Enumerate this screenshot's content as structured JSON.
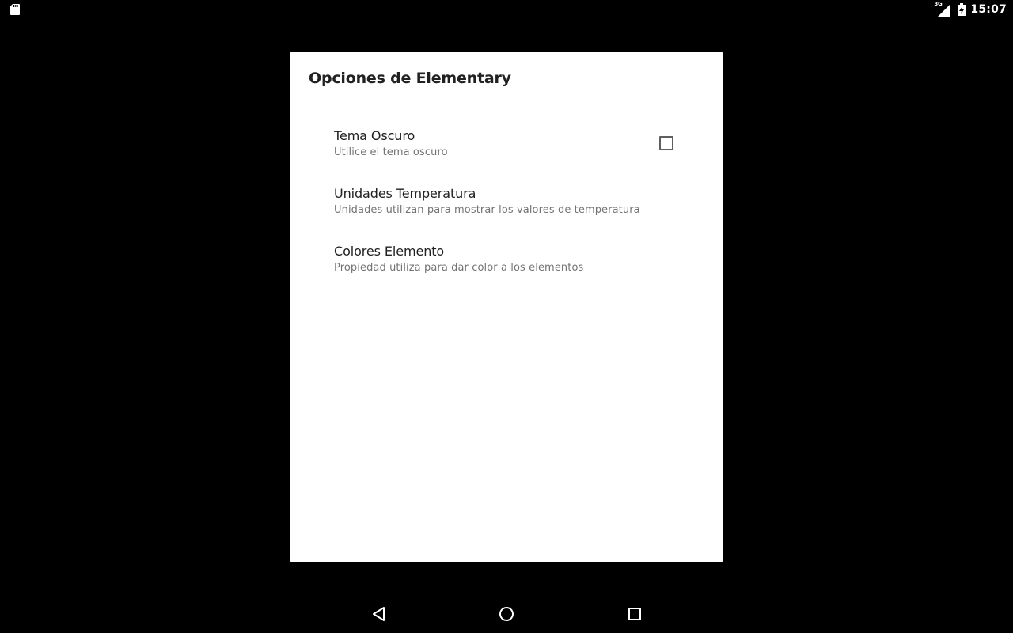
{
  "status_bar": {
    "left_icons": [
      "sd-card-icon"
    ],
    "network_type": "3G",
    "right_icons": [
      "signal-icon",
      "battery-charging-icon"
    ],
    "time": "15:07"
  },
  "dialog": {
    "title": "Opciones de Elementary",
    "preferences": [
      {
        "title": "Tema Oscuro",
        "summary": "Utilice el tema oscuro",
        "has_checkbox": true,
        "checked": false
      },
      {
        "title": "Unidades Temperatura",
        "summary": "Unidades utilizan para mostrar los valores de temperatura",
        "has_checkbox": false
      },
      {
        "title": "Colores Elemento",
        "summary": "Propiedad utiliza para dar color a los elementos",
        "has_checkbox": false
      }
    ]
  },
  "nav_bar": {
    "buttons": [
      "back-icon",
      "home-icon",
      "recents-icon"
    ]
  },
  "colors": {
    "background": "#000000",
    "dialog_background": "#ffffff",
    "title_text": "#212121",
    "summary_text": "#737373",
    "checkbox_border": "#5f5f5f",
    "system_icons": "#ffffff"
  }
}
